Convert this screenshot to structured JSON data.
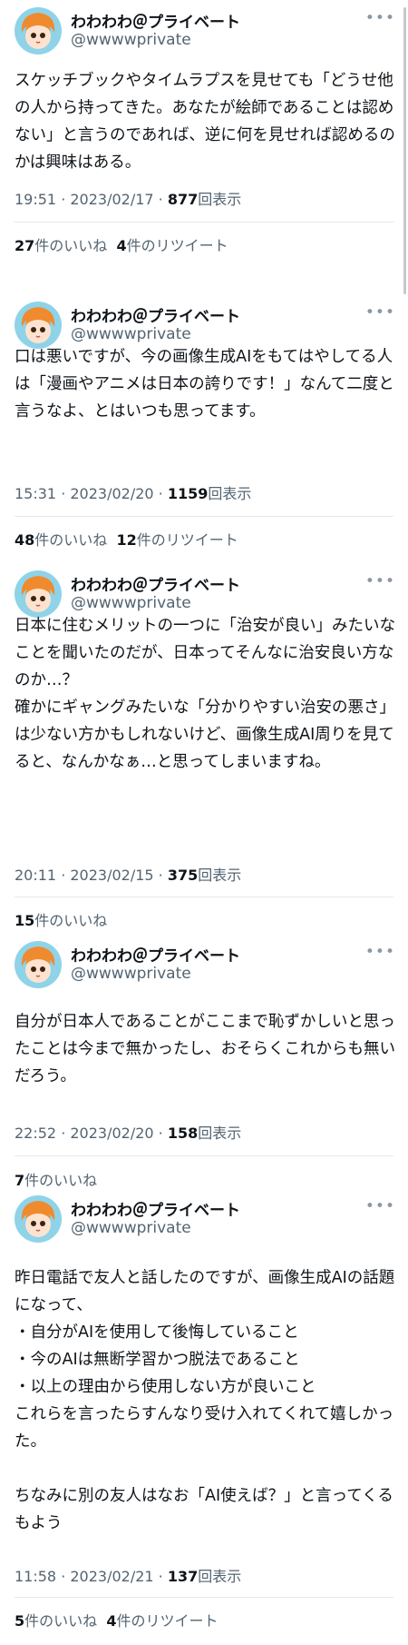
{
  "user": {
    "name": "わわわわ＠プライベート",
    "handle": "@wwwwprivate"
  },
  "more_icon": "…",
  "count_suffix": "回表示",
  "tweets": [
    {
      "text": "スケッチブックやタイムラプスを見せても「どうせ他の人から持ってきた。あなたが絵師であることは認めない」と言うのであれば、逆に何を見せれば認めるのかは興味はある。",
      "timestamp": "19:51 · 2023/02/17 · ",
      "views": "877",
      "likes": "27",
      "likes_label": "件のいいね",
      "retweets": "4",
      "retweets_label": "件のリツイート"
    },
    {
      "text": "口は悪いですが、今の画像生成AIをもてはやしてる人は「漫画やアニメは日本の誇りです！」なんて二度と言うなよ、とはいつも思ってます。",
      "timestamp": "15:31 · 2023/02/20 · ",
      "views": "1159",
      "likes": "48",
      "likes_label": "件のいいね",
      "retweets": "12",
      "retweets_label": "件のリツイート"
    },
    {
      "text": "日本に住むメリットの一つに「治安が良い」みたいなことを聞いたのだが、日本ってそんなに治安良い方なのか…？\n確かにギャングみたいな「分かりやすい治安の悪さ」は少ない方かもしれないけど、画像生成AI周りを見てると、なんかなぁ…と思ってしまいますね。",
      "timestamp": "20:11 · 2023/02/15 · ",
      "views": "375",
      "likes": "15",
      "likes_label": "件のいいね"
    },
    {
      "text": "自分が日本人であることがここまで恥ずかしいと思ったことは今まで無かったし、おそらくこれからも無いだろう。",
      "timestamp": "22:52 · 2023/02/20 · ",
      "views": "158",
      "likes": "7",
      "likes_label": "件のいいね"
    },
    {
      "text": "昨日電話で友人と話したのですが、画像生成AIの話題になって、\n・自分がAIを使用して後悔していること\n・今のAIは無断学習かつ脱法であること\n・以上の理由から使用しない方が良いこと\nこれらを言ったらすんなり受け入れてくれて嬉しかった。\n\nちなみに別の友人はなお「AI使えば？」と言ってくるもよう",
      "timestamp": "11:58 · 2023/02/21 · ",
      "views": "137",
      "likes": "5",
      "likes_label": "件のいいね",
      "retweets": "4",
      "retweets_label": "件のリツイート"
    }
  ]
}
